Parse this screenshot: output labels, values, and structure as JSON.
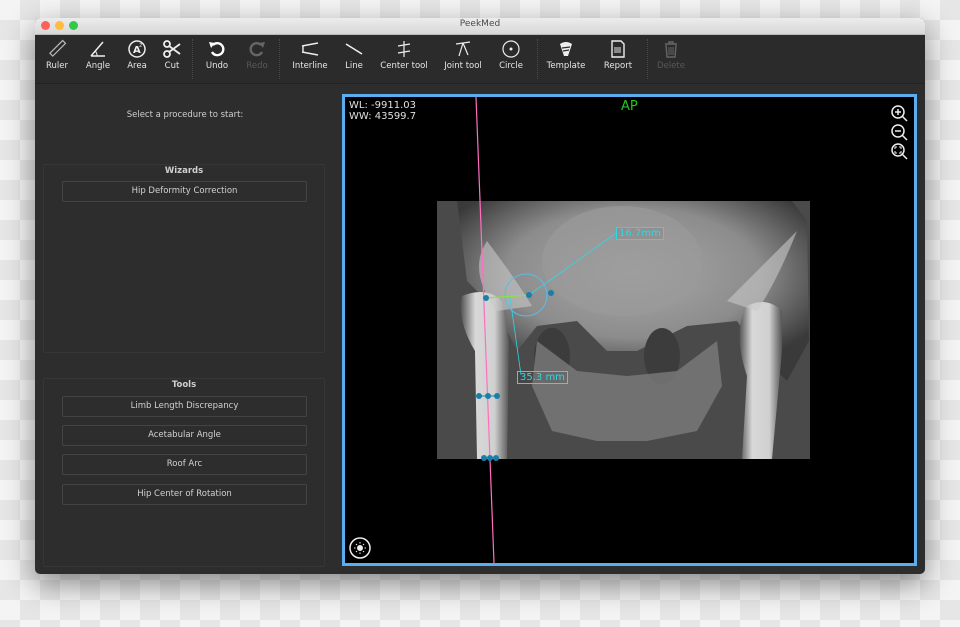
{
  "window": {
    "title": "PeekMed"
  },
  "toolbar": {
    "items": [
      {
        "label": "Ruler",
        "icon": "ruler-icon",
        "enabled": true
      },
      {
        "label": "Angle",
        "icon": "angle-icon",
        "enabled": true
      },
      {
        "label": "Area",
        "icon": "area-icon",
        "enabled": true
      },
      {
        "label": "Cut",
        "icon": "scissors-icon",
        "enabled": true
      },
      {
        "label": "Undo",
        "icon": "undo-icon",
        "enabled": true
      },
      {
        "label": "Redo",
        "icon": "redo-icon",
        "enabled": false
      },
      {
        "label": "Interline",
        "icon": "interline-icon",
        "enabled": true
      },
      {
        "label": "Line",
        "icon": "line-icon",
        "enabled": true
      },
      {
        "label": "Center tool",
        "icon": "center-tool-icon",
        "enabled": true
      },
      {
        "label": "Joint tool",
        "icon": "joint-tool-icon",
        "enabled": true
      },
      {
        "label": "Circle",
        "icon": "circle-icon",
        "enabled": true
      },
      {
        "label": "Template",
        "icon": "template-icon",
        "enabled": true
      },
      {
        "label": "Report",
        "icon": "report-icon",
        "enabled": true
      },
      {
        "label": "Delete",
        "icon": "trash-icon",
        "enabled": false
      }
    ]
  },
  "sidebar": {
    "prompt": "Select a procedure to start:",
    "wizards": {
      "title": "Wizards",
      "items": [
        "Hip Deformity Correction"
      ]
    },
    "tools": {
      "title": "Tools",
      "items": [
        "Limb Length Discrepancy",
        "Acetabular Angle",
        "Roof Arc",
        "Hip Center of Rotation"
      ]
    }
  },
  "viewer": {
    "wl": "WL: -9911.03",
    "ww": "WW: 43599.7",
    "orientation": "AP",
    "measurements": [
      "16.7mm",
      "35.3 mm"
    ],
    "controls": [
      "zoom-in",
      "zoom-out",
      "zoom-fit",
      "brightness"
    ]
  },
  "colors": {
    "accent": "#5aaef0",
    "orientation": "#1fc81f",
    "measurement": "#31d7e4",
    "axis_line": "#ff6fc0",
    "marker": "#1a7fa8",
    "offset_line": "#8de04a"
  }
}
